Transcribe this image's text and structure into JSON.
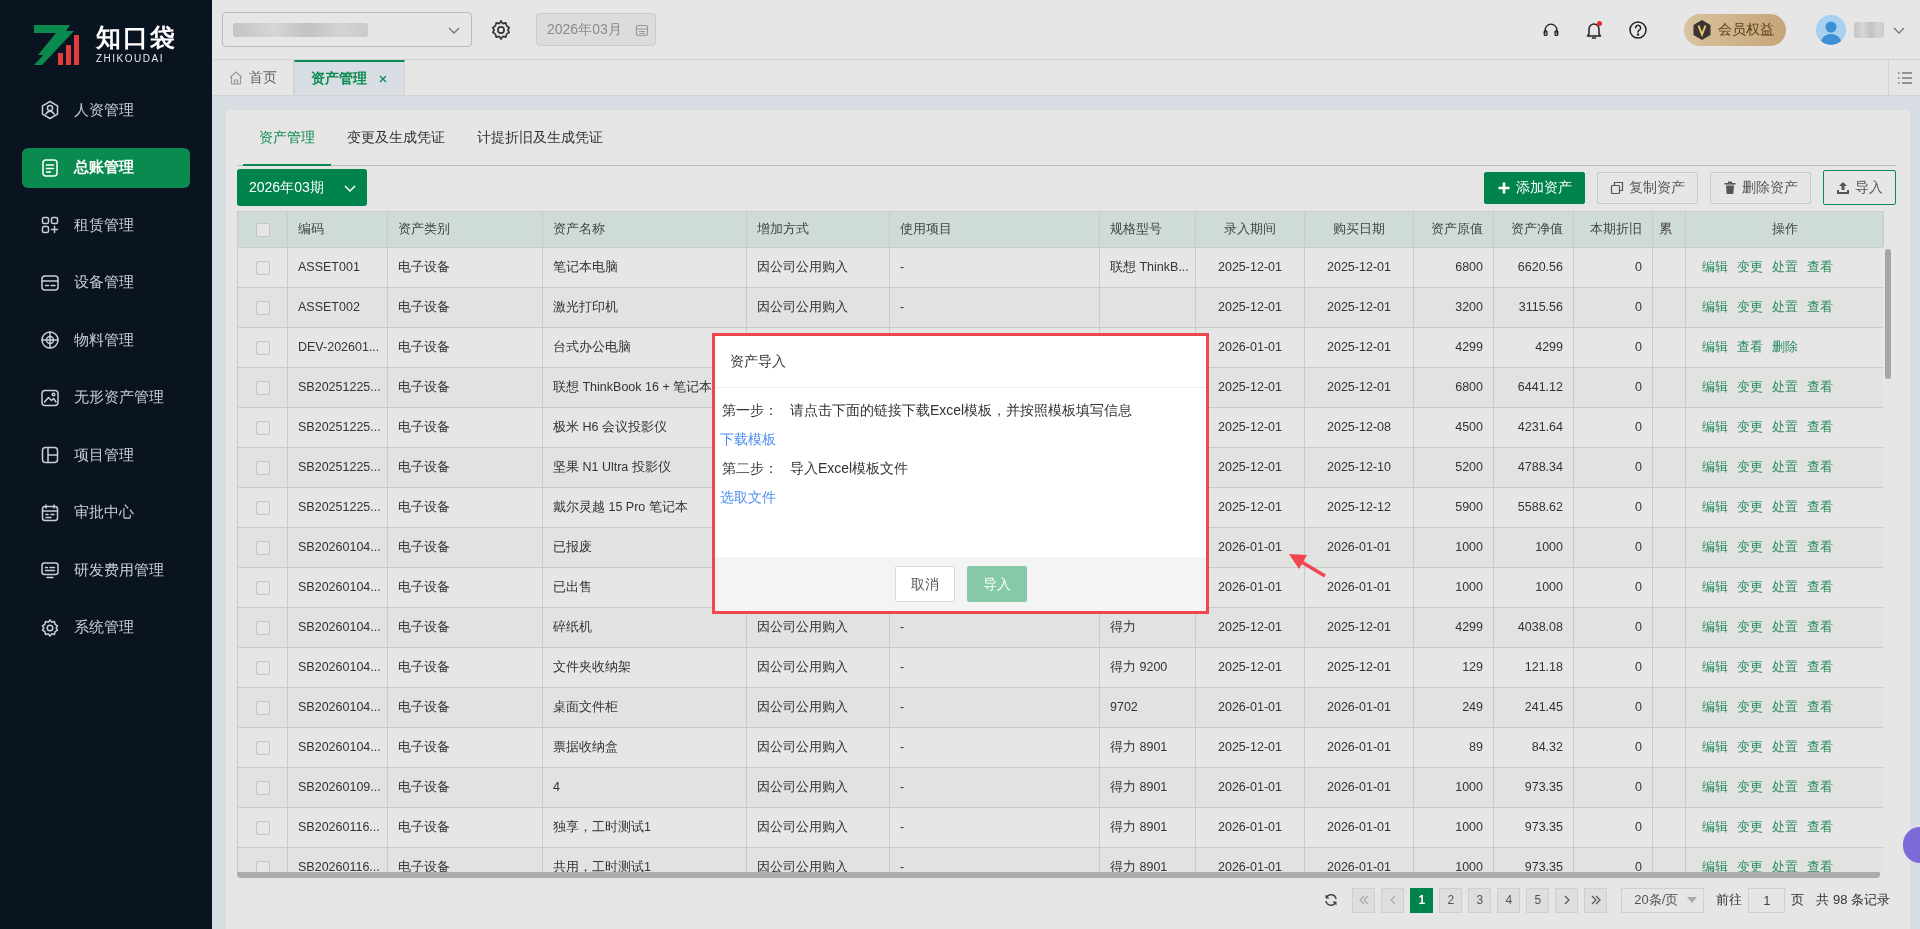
{
  "logo": {
    "name": "知口袋",
    "subtitle": "ZHIKOUDAI"
  },
  "sidebar": {
    "items": [
      {
        "label": "人资管理",
        "selected": false
      },
      {
        "label": "总账管理",
        "selected": true
      },
      {
        "label": "租赁管理",
        "selected": false
      },
      {
        "label": "设备管理",
        "selected": false
      },
      {
        "label": "物料管理",
        "selected": false
      },
      {
        "label": "无形资产管理",
        "selected": false
      },
      {
        "label": "项目管理",
        "selected": false
      },
      {
        "label": "审批中心",
        "selected": false
      },
      {
        "label": "研发费用管理",
        "selected": false
      },
      {
        "label": "系统管理",
        "selected": false
      }
    ]
  },
  "top_bar": {
    "period_field": {
      "value": "2026年03月",
      "disabled": true
    },
    "notifications_unread": true,
    "membership_badge": "会员权益"
  },
  "tabs": [
    {
      "label": "首页",
      "selected": false,
      "closable": false
    },
    {
      "label": "资产管理",
      "selected": true,
      "closable": true
    }
  ],
  "subtabs": [
    {
      "label": "资产管理",
      "selected": true
    },
    {
      "label": "变更及生成凭证",
      "selected": false
    },
    {
      "label": "计提折旧及生成凭证",
      "selected": false
    }
  ],
  "toolbar": {
    "period_select": "2026年03期",
    "buttons": [
      {
        "label": "添加资产",
        "kind": "add"
      },
      {
        "label": "复制资产",
        "kind": "copy"
      },
      {
        "label": "删除资产",
        "kind": "delete"
      },
      {
        "label": "导入",
        "kind": "upload"
      }
    ]
  },
  "table": {
    "select_all_checked": false,
    "columns": [
      "编码",
      "资产类别",
      "资产名称",
      "增加方式",
      "使用项目",
      "规格型号",
      "录入期间",
      "购买日期",
      "资产原值",
      "资产净值",
      "本期折旧",
      "累",
      "操作"
    ],
    "rows": [
      {
        "checked": false,
        "code": "ASSET001",
        "category": "电子设备",
        "name": "笔记本电脑",
        "method": "因公司公用购入",
        "project": "-",
        "spec": "联想 ThinkB...",
        "entry_period": "2025-12-01",
        "purchase_date": "2025-12-01",
        "original_value": "6800",
        "net_value": "6620.56",
        "depreciation": "0",
        "actions": [
          "编辑",
          "变更",
          "处置",
          "查看"
        ]
      },
      {
        "checked": false,
        "code": "ASSET002",
        "category": "电子设备",
        "name": "激光打印机",
        "method": "因公司公用购入",
        "project": "-",
        "entry_period": "2025-12-01",
        "purchase_date": "2025-12-01",
        "original_value": "3200",
        "net_value": "3115.56",
        "depreciation": "0",
        "actions": [
          "编辑",
          "变更",
          "处置",
          "查看"
        ]
      },
      {
        "checked": false,
        "code": "DEV-202601...",
        "category": "电子设备",
        "name": "台式办公电脑",
        "entry_period": "2026-01-01",
        "purchase_date": "2025-12-01",
        "original_value": "4299",
        "net_value": "4299",
        "depreciation": "0",
        "actions": [
          "编辑",
          "查看",
          "删除"
        ]
      },
      {
        "checked": false,
        "code": "SB20251225...",
        "category": "电子设备",
        "name": "联想 ThinkBook 16 + 笔记本",
        "entry_period": "2025-12-01",
        "purchase_date": "2025-12-01",
        "original_value": "6800",
        "net_value": "6441.12",
        "depreciation": "0",
        "actions": [
          "编辑",
          "变更",
          "处置",
          "查看"
        ]
      },
      {
        "checked": false,
        "code": "SB20251225...",
        "category": "电子设备",
        "name": "极米 H6 会议投影仪",
        "entry_period": "2025-12-01",
        "purchase_date": "2025-12-08",
        "original_value": "4500",
        "net_value": "4231.64",
        "depreciation": "0",
        "actions": [
          "编辑",
          "变更",
          "处置",
          "查看"
        ]
      },
      {
        "checked": false,
        "code": "SB20251225...",
        "category": "电子设备",
        "name": "坚果 N1 Ultra 投影仪",
        "entry_period": "2025-12-01",
        "purchase_date": "2025-12-10",
        "original_value": "5200",
        "net_value": "4788.34",
        "depreciation": "0",
        "actions": [
          "编辑",
          "变更",
          "处置",
          "查看"
        ]
      },
      {
        "checked": false,
        "code": "SB20251225...",
        "category": "电子设备",
        "name": "戴尔灵越 15 Pro 笔记本",
        "entry_period": "2025-12-01",
        "purchase_date": "2025-12-12",
        "original_value": "5900",
        "net_value": "5588.62",
        "depreciation": "0",
        "actions": [
          "编辑",
          "变更",
          "处置",
          "查看"
        ]
      },
      {
        "checked": false,
        "code": "SB20260104...",
        "category": "电子设备",
        "name": "已报废",
        "entry_period": "2026-01-01",
        "purchase_date": "2026-01-01",
        "original_value": "1000",
        "net_value": "1000",
        "depreciation": "0",
        "actions": [
          "编辑",
          "变更",
          "处置",
          "查看"
        ]
      },
      {
        "checked": false,
        "code": "SB20260104...",
        "category": "电子设备",
        "name": "已出售",
        "entry_period": "2026-01-01",
        "purchase_date": "2026-01-01",
        "original_value": "1000",
        "net_value": "1000",
        "depreciation": "0",
        "actions": [
          "编辑",
          "变更",
          "处置",
          "查看"
        ]
      },
      {
        "checked": false,
        "code": "SB20260104...",
        "category": "电子设备",
        "name": "碎纸机",
        "method": "因公司公用购入",
        "project": "-",
        "spec": "得力",
        "entry_period": "2025-12-01",
        "purchase_date": "2025-12-01",
        "original_value": "4299",
        "net_value": "4038.08",
        "depreciation": "0",
        "actions": [
          "编辑",
          "变更",
          "处置",
          "查看"
        ]
      },
      {
        "checked": false,
        "code": "SB20260104...",
        "category": "电子设备",
        "name": "文件夹收纳架",
        "method": "因公司公用购入",
        "project": "-",
        "spec": "得力 9200",
        "entry_period": "2025-12-01",
        "purchase_date": "2025-12-01",
        "original_value": "129",
        "net_value": "121.18",
        "depreciation": "0",
        "actions": [
          "编辑",
          "变更",
          "处置",
          "查看"
        ]
      },
      {
        "checked": false,
        "code": "SB20260104...",
        "category": "电子设备",
        "name": "桌面文件柜",
        "method": "因公司公用购入",
        "project": "-",
        "spec": "9702",
        "entry_period": "2026-01-01",
        "purchase_date": "2026-01-01",
        "original_value": "249",
        "net_value": "241.45",
        "depreciation": "0",
        "actions": [
          "编辑",
          "变更",
          "处置",
          "查看"
        ]
      },
      {
        "checked": false,
        "code": "SB20260104...",
        "category": "电子设备",
        "name": "票据收纳盒",
        "method": "因公司公用购入",
        "project": "-",
        "spec": "得力 8901",
        "entry_period": "2025-12-01",
        "purchase_date": "2026-01-01",
        "original_value": "89",
        "net_value": "84.32",
        "depreciation": "0",
        "actions": [
          "编辑",
          "变更",
          "处置",
          "查看"
        ]
      },
      {
        "checked": false,
        "code": "SB20260109...",
        "category": "电子设备",
        "name": "4",
        "method": "因公司公用购入",
        "project": "-",
        "spec": "得力 8901",
        "entry_period": "2026-01-01",
        "purchase_date": "2026-01-01",
        "original_value": "1000",
        "net_value": "973.35",
        "depreciation": "0",
        "actions": [
          "编辑",
          "变更",
          "处置",
          "查看"
        ]
      },
      {
        "checked": false,
        "code": "SB20260116...",
        "category": "电子设备",
        "name": "独享，工时测试1",
        "method": "因公司公用购入",
        "project": "-",
        "spec": "得力 8901",
        "entry_period": "2026-01-01",
        "purchase_date": "2026-01-01",
        "original_value": "1000",
        "net_value": "973.35",
        "depreciation": "0",
        "actions": [
          "编辑",
          "变更",
          "处置",
          "查看"
        ]
      },
      {
        "checked": false,
        "code": "SB20260116...",
        "category": "电子设备",
        "name": "共用，工时测试1",
        "method": "因公司公用购入",
        "project": "-",
        "spec": "得力 8901",
        "entry_period": "2026-01-01",
        "purchase_date": "2026-01-01",
        "original_value": "1000",
        "net_value": "973.35",
        "depreciation": "0",
        "actions": [
          "编辑",
          "变更",
          "处置",
          "查看"
        ]
      }
    ]
  },
  "pagination": {
    "pages": [
      {
        "label": "1",
        "selected": true
      },
      {
        "label": "2",
        "selected": false
      },
      {
        "label": "3",
        "selected": false
      },
      {
        "label": "4",
        "selected": false
      },
      {
        "label": "5",
        "selected": false
      }
    ],
    "page_size": "20条/页",
    "goto_label": "前往",
    "goto_value": "1",
    "page_unit": "页",
    "total": "共 98 条记录"
  },
  "dialog": {
    "title": "资产导入",
    "steps": [
      {
        "label": "第一步：",
        "text": "请点击下面的链接下载Excel模板，并按照模板填写信息",
        "link": "下载模板"
      },
      {
        "label": "第二步：",
        "text": "导入Excel模板文件",
        "link": "选取文件"
      }
    ],
    "buttons": [
      {
        "label": "取消",
        "kind": "default",
        "disabled": false
      },
      {
        "label": "导入",
        "kind": "primary",
        "disabled": true
      }
    ]
  }
}
